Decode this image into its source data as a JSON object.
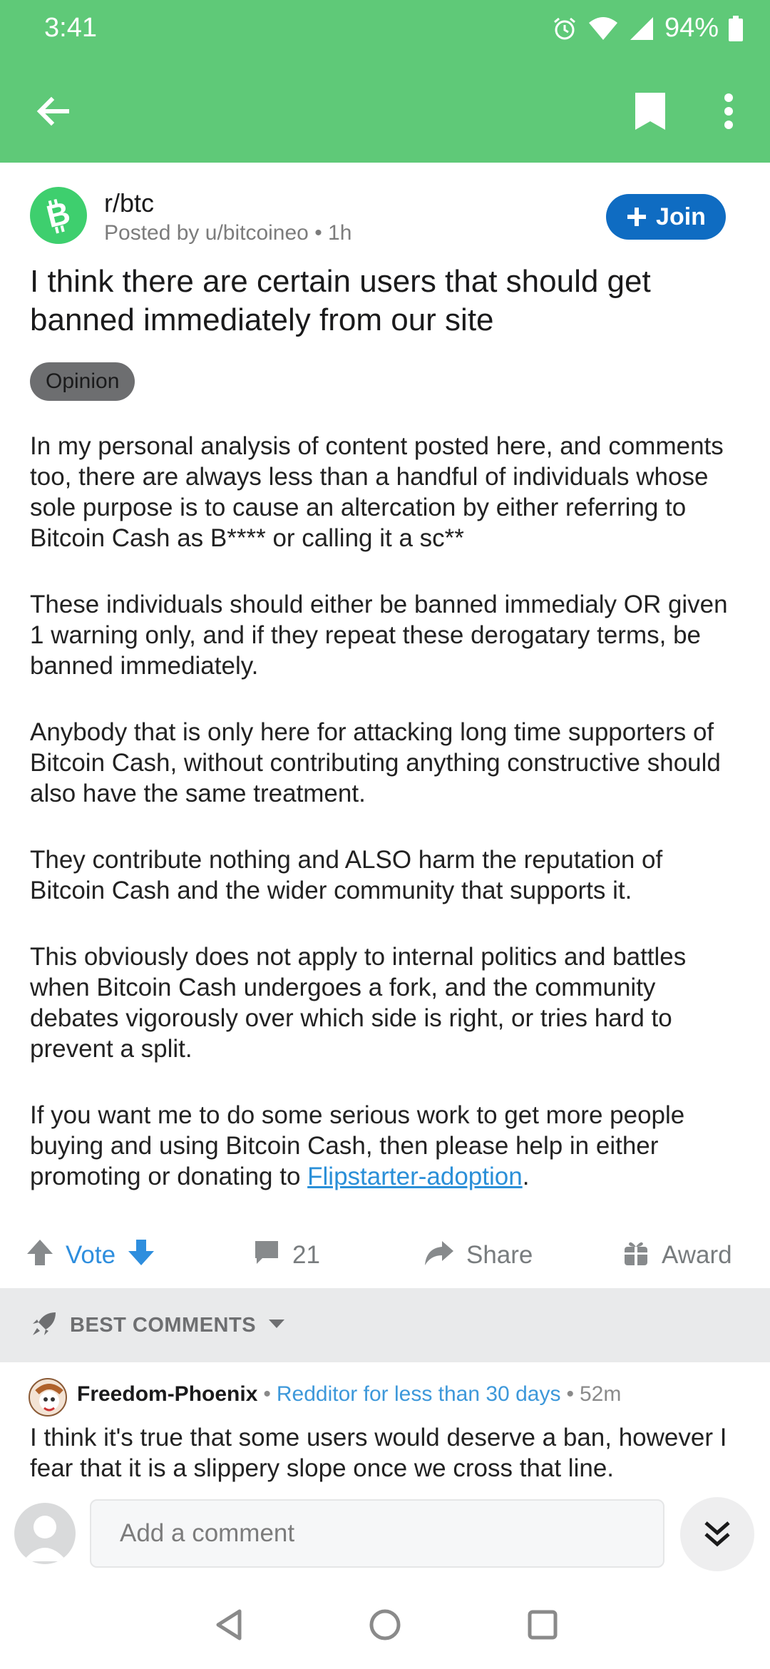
{
  "status": {
    "time": "3:41",
    "battery": "94%",
    "icons": [
      "alarm-icon",
      "wifi-icon",
      "signal-icon",
      "battery-icon"
    ]
  },
  "toolbar": {
    "icons": [
      "back-arrow-icon",
      "bookmark-icon",
      "more-vert-icon"
    ],
    "color": "#5fc978"
  },
  "post": {
    "subreddit": "r/btc",
    "posted_by": "Posted by u/bitcoineo • 1h",
    "join_label": "Join",
    "title": "I think there are certain users that should get banned immediately from our site",
    "flair": "Opinion",
    "paragraphs": [
      "In my personal analysis of content posted here, and comments too, there are always less than a handful of individuals whose sole purpose is to cause an altercation by either referring to Bitcoin Cash as B**** or calling it a sc**",
      "These individuals should either be banned immedialy OR given 1 warning only, and if they repeat these derogatary terms, be banned immediately.",
      "Anybody that is only here for attacking long time supporters of Bitcoin Cash, without contributing anything constructive should also have the same treatment.",
      "They contribute nothing and ALSO harm the reputation of Bitcoin Cash and the wider community that supports it.",
      "This obviously does not apply to internal politics and battles when Bitcoin Cash undergoes a fork, and the community debates vigorously over which side is right, or tries hard to prevent a split."
    ],
    "last_paragraph_before_link": "If you want me to do some serious work to get more people buying and using Bitcoin Cash, then please help in either promoting or donating to ",
    "link_text": "Flipstarter-adoption",
    "last_paragraph_after_link": "."
  },
  "actions": {
    "vote_label": "Vote",
    "comments_count": "21",
    "share_label": "Share",
    "award_label": "Award"
  },
  "sort": {
    "label": "BEST COMMENTS"
  },
  "comment": {
    "author": "Freedom-Phoenix",
    "separator1": "•",
    "flair": "Redditor for less than 30 days",
    "separator2": "•",
    "time": "52m",
    "text": "I think it's true that some users would deserve a ban, however I fear that it is a slippery slope once we cross that line."
  },
  "input": {
    "placeholder": "Add a comment"
  },
  "colors": {
    "accent_green": "#5fc978",
    "join_blue": "#0f6cc2",
    "link_blue": "#2a8fd8"
  }
}
